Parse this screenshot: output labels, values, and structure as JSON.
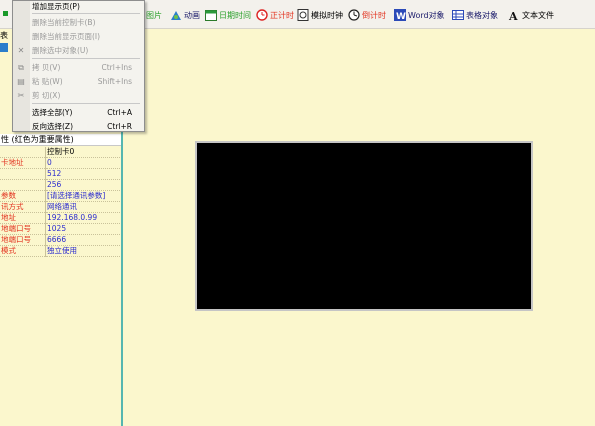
{
  "toolbar": {
    "items": [
      {
        "label": "图片",
        "icon": "image-icon"
      },
      {
        "label": "动画",
        "icon": "animation-icon"
      },
      {
        "label": "日期时间",
        "icon": "calendar-icon"
      },
      {
        "label": "正计时",
        "icon": "timer-icon"
      },
      {
        "label": "模拟时钟",
        "icon": "analog-clock-icon"
      },
      {
        "label": "倒计时",
        "icon": "countdown-icon"
      },
      {
        "label": "Word对象",
        "icon": "word-icon"
      },
      {
        "label": "表格对象",
        "icon": "table-icon"
      },
      {
        "label": "文本文件",
        "icon": "text-file-icon"
      }
    ]
  },
  "context_menu": {
    "items": [
      {
        "label": "增加显示页(P)",
        "enabled": true
      },
      {
        "label": "删除当前控制卡(B)",
        "enabled": false
      },
      {
        "label": "删除当前显示页面(I)",
        "enabled": false
      },
      {
        "label": "删除选中对象(U)",
        "enabled": false
      },
      {
        "label": "拷 贝(V)",
        "shortcut": "Ctrl+Ins",
        "enabled": false
      },
      {
        "label": "粘 贴(W)",
        "shortcut": "Shift+Ins",
        "enabled": false
      },
      {
        "label": "剪 切(X)",
        "enabled": false
      },
      {
        "label": "选择全部(Y)",
        "shortcut": "Ctrl+A",
        "enabled": true
      },
      {
        "label": "反向选择(Z)",
        "shortcut": "Ctrl+R",
        "enabled": true
      }
    ]
  },
  "left_panel": {
    "stub_top": "表",
    "property_header": "性 (红色为重要属性)",
    "properties": [
      {
        "key": "",
        "value": "控制卡0"
      },
      {
        "key": "卡地址",
        "value": "0"
      },
      {
        "key": "",
        "value": "512"
      },
      {
        "key": "",
        "value": "256"
      },
      {
        "key": "参数",
        "value": "[请选择通讯参数]"
      },
      {
        "key": "讯方式",
        "value": "网络通讯"
      },
      {
        "key": "地址",
        "value": "192.168.0.99"
      },
      {
        "key": "地端口号",
        "value": "1025"
      },
      {
        "key": "地端口号",
        "value": "6666"
      },
      {
        "key": "模式",
        "value": "独立使用"
      }
    ]
  },
  "colors": {
    "background": "#fbf7cd",
    "important_key": "#e2321f",
    "value": "#2c2ccf",
    "panel_border": "#55b6b0",
    "screen": "#000000"
  }
}
